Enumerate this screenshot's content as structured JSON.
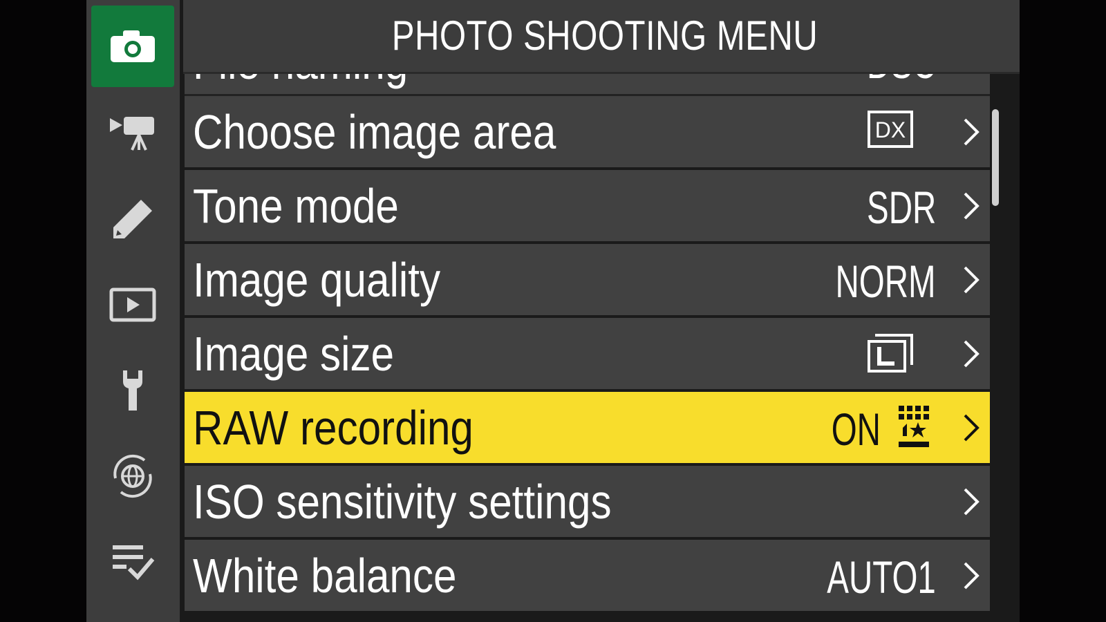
{
  "header": {
    "title": "PHOTO SHOOTING MENU",
    "help_label": "?"
  },
  "sidebar": {
    "tabs": [
      {
        "icon": "camera-icon",
        "active": true
      },
      {
        "icon": "movie-camera-icon",
        "active": false
      },
      {
        "icon": "pencil-icon",
        "active": false
      },
      {
        "icon": "playback-icon",
        "active": false
      },
      {
        "icon": "wrench-icon",
        "active": false
      },
      {
        "icon": "network-globe-icon",
        "active": false
      },
      {
        "icon": "my-menu-checklist-icon",
        "active": false
      }
    ]
  },
  "menu": {
    "clipped_top": {
      "label": "File naming",
      "value": "DSC"
    },
    "items": [
      {
        "label": "Choose image area",
        "value": "DX",
        "value_icon": "dx-frame-icon"
      },
      {
        "label": "Tone mode",
        "value": "SDR"
      },
      {
        "label": "Image quality",
        "value": "NORM"
      },
      {
        "label": "Image size",
        "value": "",
        "value_icon": "large-size-icon"
      },
      {
        "label": "RAW recording",
        "value": "ON",
        "value_icon": "raw-compression-icon",
        "selected": true
      },
      {
        "label": "ISO sensitivity settings",
        "value": ""
      },
      {
        "label": "White balance",
        "value": "AUTO1"
      }
    ]
  },
  "colors": {
    "selected_row": "#f8dd2c",
    "active_tab": "#127a3c",
    "row_bg": "#414141"
  }
}
